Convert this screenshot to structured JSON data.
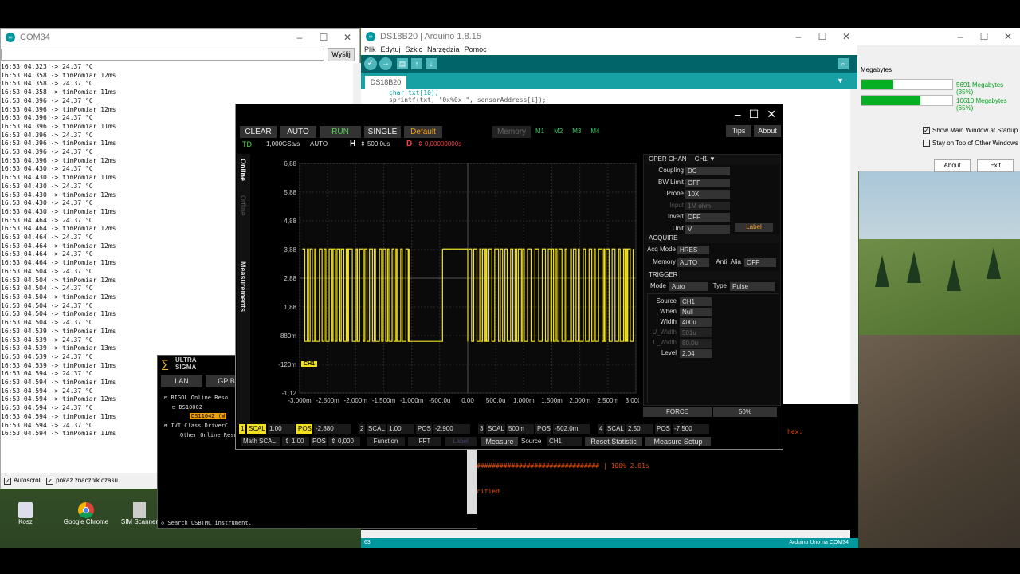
{
  "com34": {
    "title": "COM34",
    "send_label": "Wyślij",
    "input_value": "",
    "log": [
      "16:53:04.323 -> 24.37 °C",
      "16:53:04.358 -> timPomiar 12ms",
      "16:53:04.358 -> 24.37 °C",
      "16:53:04.358 -> timPomiar 11ms",
      "16:53:04.396 -> 24.37 °C",
      "16:53:04.396 -> timPomiar 12ms",
      "16:53:04.396 -> 24.37 °C",
      "16:53:04.396 -> timPomiar 11ms",
      "16:53:04.396 -> 24.37 °C",
      "16:53:04.396 -> timPomiar 11ms",
      "16:53:04.396 -> 24.37 °C",
      "16:53:04.396 -> timPomiar 12ms",
      "16:53:04.430 -> 24.37 °C",
      "16:53:04.430 -> timPomiar 11ms",
      "16:53:04.430 -> 24.37 °C",
      "16:53:04.430 -> timPomiar 12ms",
      "16:53:04.430 -> 24.37 °C",
      "16:53:04.430 -> timPomiar 11ms",
      "16:53:04.464 -> 24.37 °C",
      "16:53:04.464 -> timPomiar 12ms",
      "16:53:04.464 -> 24.37 °C",
      "16:53:04.464 -> timPomiar 12ms",
      "16:53:04.464 -> 24.37 °C",
      "16:53:04.464 -> timPomiar 11ms",
      "16:53:04.504 -> 24.37 °C",
      "16:53:04.504 -> timPomiar 12ms",
      "16:53:04.504 -> 24.37 °C",
      "16:53:04.504 -> timPomiar 12ms",
      "16:53:04.504 -> 24.37 °C",
      "16:53:04.504 -> timPomiar 11ms",
      "16:53:04.504 -> 24.37 °C",
      "16:53:04.539 -> timPomiar 11ms",
      "16:53:04.539 -> 24.37 °C",
      "16:53:04.539 -> timPomiar 13ms",
      "16:53:04.539 -> 24.37 °C",
      "16:53:04.539 -> timPomiar 11ms",
      "16:53:04.594 -> 24.37 °C",
      "16:53:04.594 -> timPomiar 11ms",
      "16:53:04.594 -> 24.37 °C",
      "16:53:04.594 -> timPomiar 12ms",
      "16:53:04.594 -> 24.37 °C",
      "16:53:04.594 -> timPomiar 11ms",
      "16:53:04.594 -> 24.37 °C",
      "16:53:04.594 -> timPomiar 11ms"
    ],
    "autoscroll": "Autoscroll",
    "timestamp": "pokaż znacznik czasu"
  },
  "arduino": {
    "title": "DS18B20 | Arduino 1.8.15",
    "menu": [
      "Plik",
      "Edytuj",
      "Szkic",
      "Narzędzia",
      "Pomoc"
    ],
    "tab": "DS18B20",
    "code": [
      "char txt[10];",
      "sprintf(txt, \"0x%0x \", sensorAddress[i]);"
    ],
    "console_hex": "hex:",
    "console_progress": "################################ | 100% 2.01s",
    "console_verified": "rified",
    "status_left": "63",
    "status_right": "Arduino Uno na COM34"
  },
  "taskmgr": {
    "label1": "Megabytes",
    "mem1": "5691 Megabytes (35%)",
    "mem1_pct": 0.35,
    "mem2": "10610 Megabytes (65%)",
    "mem2_pct": 0.65,
    "opt1": "Show Main Window at Startup",
    "opt2": "Stay on Top of Other Windows",
    "about": "About",
    "exit": "Exit"
  },
  "ultrasigma": {
    "logo1": "ULTRA",
    "logo2": "SIGMA",
    "tabs": [
      "LAN",
      "GPIB"
    ],
    "tree": [
      "RIGOL Online Reso",
      "DS1000Z",
      "DS1104Z (W",
      "IVI Class DriverC",
      "Other Online Reso"
    ],
    "search": "Search USBTMC instrument."
  },
  "desktop": {
    "icons": [
      "Kosz",
      "Google Chrome",
      "SIM Scanner"
    ]
  },
  "scope": {
    "buttons": {
      "clear": "CLEAR",
      "auto": "AUTO",
      "run": "RUN",
      "single": "SINGLE",
      "default": "Default",
      "memory": "Memory",
      "m1": "M1",
      "m2": "M2",
      "m3": "M3",
      "m4": "M4",
      "tips": "Tips",
      "about": "About"
    },
    "status": {
      "td": "TD",
      "rate": "1,000GSa/s",
      "mode": "AUTO",
      "h_label": "H",
      "h_value": "500,0us",
      "d_label": "D",
      "d_value": "0,00000000s"
    },
    "side_tabs": [
      "Online",
      "Offline",
      "Measurements"
    ],
    "ch_marker": "CH1",
    "oper_chan": {
      "label": "OPER CHAN",
      "value": "CH1"
    },
    "channel": [
      {
        "label": "Coupling",
        "value": "DC",
        "dis": false
      },
      {
        "label": "BW Limit",
        "value": "OFF",
        "dis": false
      },
      {
        "label": "Probe",
        "value": "10X",
        "dis": false
      },
      {
        "label": "Input",
        "value": "1M ohm",
        "dis": true
      },
      {
        "label": "Invert",
        "value": "OFF",
        "dis": false
      },
      {
        "label": "Unit",
        "value": "V",
        "dis": false
      }
    ],
    "label_btn": "Label",
    "acquire": {
      "title": "ACQUIRE",
      "acq_mode_label": "Acq Mode",
      "acq_mode": "HRES",
      "memory_label": "Memory",
      "memory": "AUTO",
      "anti_label": "Anti_Alia",
      "anti": "OFF"
    },
    "trigger": {
      "title": "TRIGGER",
      "mode_label": "Mode",
      "mode": "Auto",
      "type_label": "Type",
      "type": "Pulse",
      "rows": [
        {
          "label": "Source",
          "value": "CH1",
          "dis": false
        },
        {
          "label": "When",
          "value": "Null",
          "dis": false
        },
        {
          "label": "Width",
          "value": "400u",
          "dis": false
        },
        {
          "label": "U_Width",
          "value": "501u",
          "dis": true
        },
        {
          "label": "L_Width",
          "value": "80,0u",
          "dis": true
        },
        {
          "label": "Level",
          "value": "2,04",
          "dis": false
        }
      ],
      "force": "FORCE",
      "pct": "50%"
    },
    "bottom_row1": [
      {
        "num": "1",
        "scal": "SCAL",
        "scal_v": "1,00",
        "pos": "POS",
        "pos_v": "-2,880"
      },
      {
        "num": "2",
        "scal": "SCAL",
        "scal_v": "1,00",
        "pos": "POS",
        "pos_v": "-2,900"
      },
      {
        "num": "3",
        "scal": "SCAL",
        "scal_v": "500m",
        "pos": "POS",
        "pos_v": "-502,0m"
      },
      {
        "num": "4",
        "scal": "SCAL",
        "scal_v": "2,50",
        "pos": "POS",
        "pos_v": "-7,500"
      }
    ],
    "bottom_row2": {
      "math": "Math SCAL",
      "math_v": "1,00",
      "pos": "POS",
      "pos_v": "0,000",
      "function": "Function",
      "fft": "FFT",
      "label": "Label",
      "measure": "Measure",
      "source": "Source",
      "source_v": "CH1",
      "reset": "Reset  Statistic",
      "setup": "Measure Setup"
    }
  },
  "chart_data": {
    "type": "line",
    "title": "",
    "xlabel": "",
    "ylabel": "",
    "y_ticks": [
      "6,88",
      "5,88",
      "4,88",
      "3,88",
      "2,88",
      "1,88",
      "880m",
      "-120m",
      "-1,12"
    ],
    "x_ticks": [
      "-3,000m",
      "-2,500m",
      "-2,000m",
      "-1,500m",
      "-1,000m",
      "-500,0u",
      "0,00",
      "500,0u",
      "1,000m",
      "1,500m",
      "2,000m",
      "2,500m",
      "3,000m"
    ],
    "xlim": [
      -3.0,
      3.0
    ],
    "ylim": [
      -1.12,
      6.88
    ],
    "grid": true,
    "series": [
      {
        "name": "CH1",
        "color": "#f0e020",
        "high": 3.9,
        "low": 0.68,
        "segments": [
          {
            "x": [
              -2.95,
              -1.05
            ],
            "type": "burst"
          },
          {
            "x": [
              -1.05,
              -0.45
            ],
            "type": "low"
          },
          {
            "x": [
              -0.45,
              0.0
            ],
            "type": "high"
          },
          {
            "x": [
              0.02,
              2.95
            ],
            "type": "burst"
          }
        ]
      }
    ]
  }
}
